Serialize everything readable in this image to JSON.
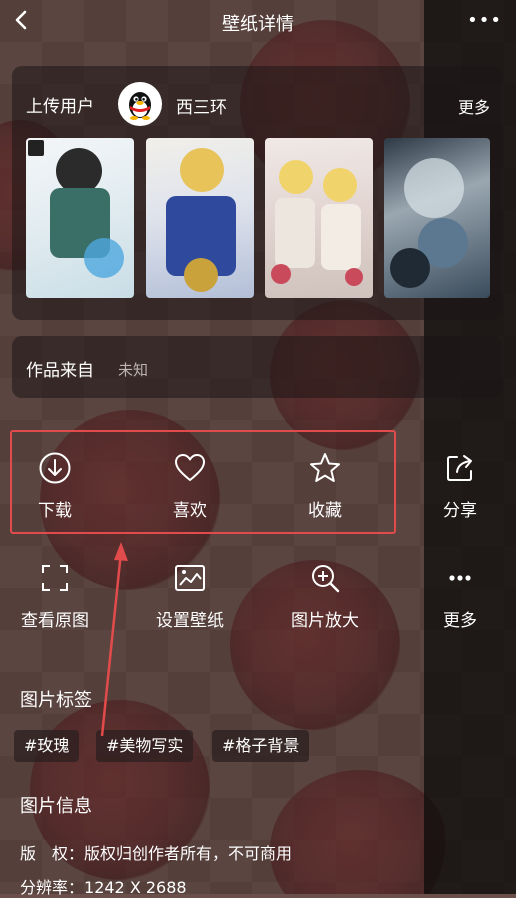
{
  "header": {
    "back_icon": "chevron-left-icon",
    "title": "壁纸详情",
    "menu_icon": "more-dots-icon",
    "menu_glyph": "•••"
  },
  "uploader": {
    "label": "上传用户",
    "avatar_icon": "qq-penguin-icon",
    "name": "西三环",
    "more": "更多"
  },
  "source": {
    "label": "作品来自",
    "value": "未知"
  },
  "actions": {
    "download": "下载",
    "like": "喜欢",
    "favorite": "收藏",
    "share": "分享",
    "view_original": "查看原图",
    "set_wallpaper": "设置壁纸",
    "zoom": "图片放大",
    "more": "更多"
  },
  "tags": {
    "title": "图片标签",
    "items": [
      "#玫瑰",
      "#美物写实",
      "#格子背景"
    ]
  },
  "info": {
    "title": "图片信息",
    "copyright_label": "版　权：",
    "copyright_value": "版权归创作者所有，不可商用",
    "resolution_label": "分辨率：",
    "resolution_value": "1242 X 2688"
  },
  "colors": {
    "highlight_border": "#e24b4b",
    "annotation_arrow": "#e24b4b"
  }
}
